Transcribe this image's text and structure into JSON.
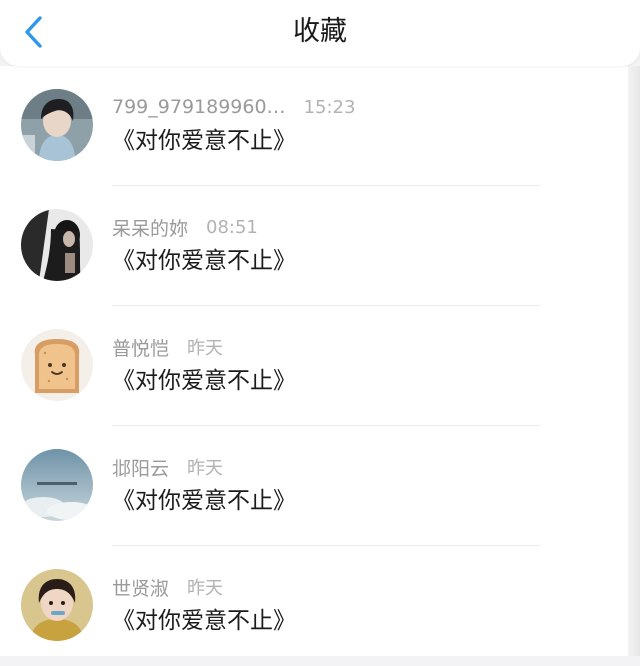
{
  "header": {
    "title": "收藏",
    "back_icon": "chevron-left-icon",
    "back_color": "#2f97ea"
  },
  "items": [
    {
      "name": "799_979189960…",
      "time": "15:23",
      "message": "《对你爱意不止》",
      "avatar_icon": "avatar-person-icon"
    },
    {
      "name": "呆呆的妳",
      "time": "08:51",
      "message": "《对你爱意不止》",
      "avatar_icon": "avatar-silhouette-icon"
    },
    {
      "name": "普悦恺",
      "time": "昨天",
      "message": "《对你爱意不止》",
      "avatar_icon": "avatar-toast-icon"
    },
    {
      "name": "邶阳云",
      "time": "昨天",
      "message": "《对你爱意不止》",
      "avatar_icon": "avatar-sky-icon"
    },
    {
      "name": "世贤淑",
      "time": "昨天",
      "message": "《对你爱意不止》",
      "avatar_icon": "avatar-child-icon"
    }
  ]
}
